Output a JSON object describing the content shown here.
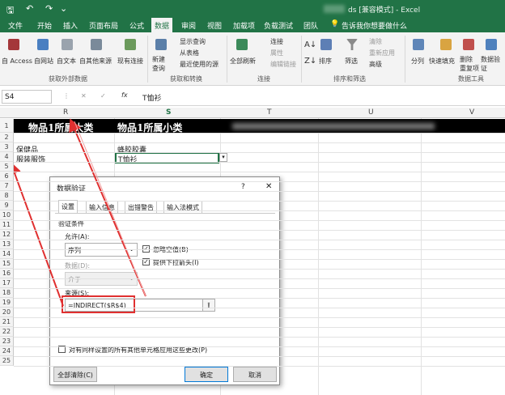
{
  "quick_access": {
    "save": "🖫",
    "undo": "↶",
    "redo": "↷",
    "customize": "⌄"
  },
  "window_title": "ds [兼容模式] - Excel",
  "tabs": [
    "文件",
    "开始",
    "插入",
    "页面布局",
    "公式",
    "数据",
    "审阅",
    "视图",
    "加载项",
    "负载测试",
    "团队"
  ],
  "active_tab": "数据",
  "tellme": "告诉我你想要做什么",
  "ribbon": {
    "get_external": {
      "items": [
        "自 Access",
        "自网站",
        "自文本",
        "自其他来源",
        "现有连接"
      ],
      "group": "获取外部数据"
    },
    "get_transform": {
      "new_query": "新建\n查询",
      "show_queries": "显示查询",
      "from_table": "从表格",
      "recent": "最近使用的源",
      "group": "获取和转换"
    },
    "connections": {
      "refresh_all": "全部刷新",
      "connections": "连接",
      "properties": "属性",
      "edit_links": "编辑链接",
      "group": "连接"
    },
    "sort_filter": {
      "sort": "排序",
      "filter": "筛选",
      "clear": "清除",
      "reapply": "重新应用",
      "advanced": "高级",
      "group": "排序和筛选"
    },
    "data_tools": {
      "split": "分列",
      "flash_fill": "快速填充",
      "remove_dup": "删除\n重复项",
      "validate": "数据验\n证",
      "group": "数据工具"
    }
  },
  "name_box": "S4",
  "formula_icons": {
    "cancel": "✕",
    "enter": "✓",
    "fx": "fx"
  },
  "formula_value": "T恤衫",
  "columns": [
    "R",
    "S",
    "T",
    "U",
    "V"
  ],
  "rows": [
    "1",
    "2",
    "3",
    "4",
    "5",
    "6",
    "7",
    "8",
    "9",
    "10",
    "11",
    "12",
    "13",
    "14",
    "15",
    "16",
    "17",
    "18",
    "19",
    "20",
    "21",
    "22",
    "23",
    "24",
    "25"
  ],
  "cells": {
    "r1": "物品1所属大类",
    "s1": "物品1所属小类",
    "r3": "保健品",
    "s3": "蜂胶胶囊",
    "r4": "服装服饰",
    "s4": "T恤衫"
  },
  "dialog": {
    "title": "数据验证",
    "help": "?",
    "close": "✕",
    "tabs": [
      "设置",
      "输入信息",
      "出错警告",
      "输入法模式"
    ],
    "criteria": "验证条件",
    "allow_label": "允许(A):",
    "allow_value": "序列",
    "ignore_blank": "忽略空值(B)",
    "dropdown": "提供下拉箭头(I)",
    "data_label": "数据(D):",
    "data_value": "介于",
    "source_label": "来源(S):",
    "source_value": "=INDIRECT($R$4)",
    "apply_all": "对有同样设置的所有其他单元格应用这些更改(P)",
    "clear_all": "全部清除(C)",
    "ok": "确定",
    "cancel": "取消"
  },
  "colors": {
    "excel_green": "#217346",
    "annotation_red": "#e03030"
  }
}
